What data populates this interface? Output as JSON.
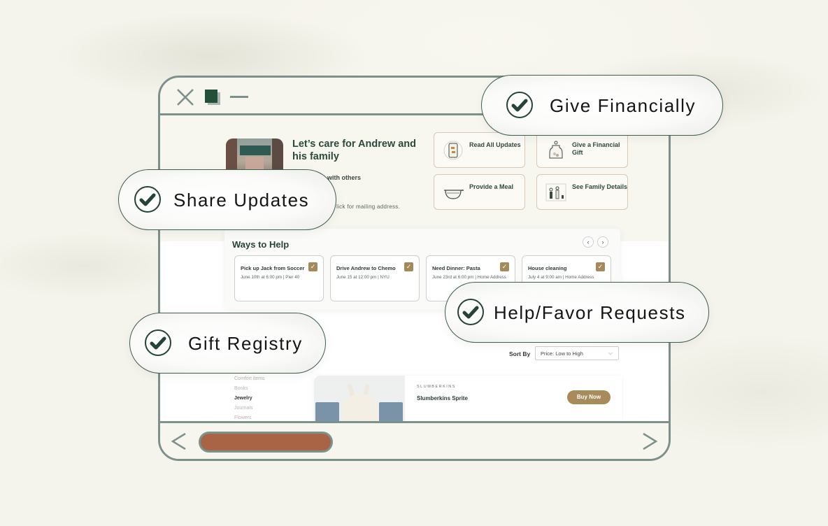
{
  "window": {
    "controls": {
      "close_icon": "close-icon",
      "maximize_icon": "maximize-icon",
      "minimize_icon": "minimize-icon"
    }
  },
  "hero": {
    "title": "Let’s care for Andrew and his family",
    "subtitle_partial": "age with others",
    "mailing_partial": "lick for mailing address."
  },
  "actions": [
    {
      "label": "Read All Updates",
      "icon": "updates-phone-icon"
    },
    {
      "label": "Give a Financial Gift",
      "icon": "money-jar-icon"
    },
    {
      "label": "Provide a Meal",
      "icon": "meal-pot-icon"
    },
    {
      "label": "See Family Details",
      "icon": "family-icon"
    }
  ],
  "ways_to_help": {
    "title": "Ways to Help",
    "prev_icon": "‹",
    "next_icon": "›",
    "cards": [
      {
        "title": "Pick up Jack from Soccer",
        "detail": "June 10th at 6:00 pm | Pier 40",
        "checked": true
      },
      {
        "title": "Drive Andrew to Chemo",
        "detail": "June 15 at 12:00 pm | NYU",
        "checked": true
      },
      {
        "title": "Need Dinner: Pasta",
        "detail": "June 23rd at 6:00 pm | Home Address",
        "checked": true
      },
      {
        "title": "House cleaning",
        "detail": "July 4 at 9:00 am | Home Address",
        "checked": true
      }
    ],
    "check_glyph": "✓"
  },
  "registry": {
    "sort_label": "Sort By",
    "sort_value": "Price: Low to High",
    "sort_caret": "⌵",
    "categories": [
      {
        "label": "Comfort items",
        "active": false
      },
      {
        "label": "Books",
        "active": false
      },
      {
        "label": "Jewelry",
        "active": true
      },
      {
        "label": "Journals",
        "active": false
      },
      {
        "label": "Flowers",
        "active": false
      }
    ],
    "product": {
      "brand": "SLUMBERKINS",
      "name": "Slumberkins Sprite",
      "buy_label": "Buy Now"
    }
  },
  "scrollbar": {
    "position_fraction": 0.0,
    "thumb_fraction": 0.29
  },
  "features": [
    {
      "label": "Give Financially"
    },
    {
      "label": "Share Updates"
    },
    {
      "label": "Help/Favor Requests"
    },
    {
      "label": "Gift Registry"
    }
  ],
  "colors": {
    "frame": "#7a918c",
    "accent_green": "#24443a",
    "gold": "#a88a5b",
    "scroll_thumb": "#a96446",
    "background": "#f5f4ec"
  }
}
